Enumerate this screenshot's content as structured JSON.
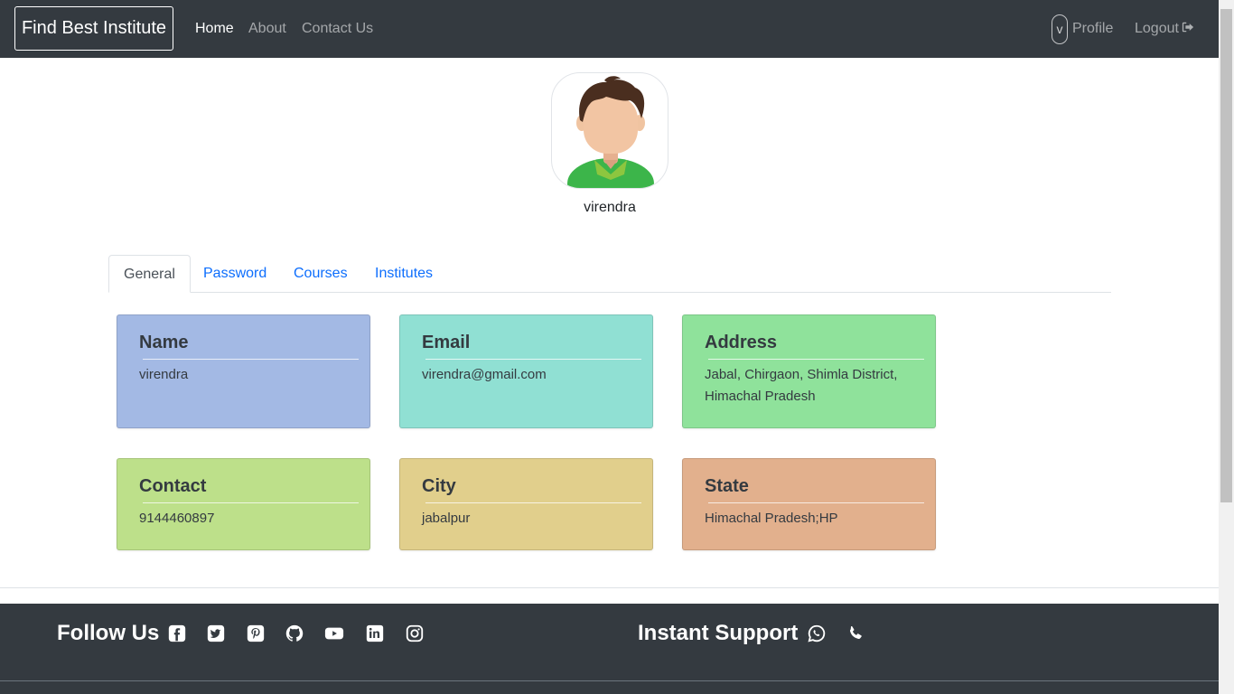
{
  "navbar": {
    "brand": "Find Best Institute",
    "links": [
      "Home",
      "About",
      "Contact Us"
    ],
    "avatar_initial": "v",
    "profile_label": "Profile",
    "logout_label": "Logout"
  },
  "profile": {
    "username": "virendra"
  },
  "tabs": [
    "General",
    "Password",
    "Courses",
    "Institutes"
  ],
  "active_tab": "General",
  "cards": [
    {
      "title": "Name",
      "value": "virendra",
      "color": "#a3b9e4"
    },
    {
      "title": "Email",
      "value": "virendra@gmail.com",
      "color": "#90e0d3"
    },
    {
      "title": "Address",
      "value": "Jabal, Chirgaon, Shimla District, Himachal Pradesh",
      "color": "#8fe29b"
    },
    {
      "title": "Contact",
      "value": "9144460897",
      "color": "#bde08a"
    },
    {
      "title": "City",
      "value": "jabalpur",
      "color": "#e1cf8c"
    },
    {
      "title": "State",
      "value": "Himachal Pradesh;HP",
      "color": "#e2b08d"
    }
  ],
  "footer": {
    "follow_heading": "Follow Us",
    "social_icons": [
      "facebook-icon",
      "twitter-icon",
      "pinterest-icon",
      "github-icon",
      "youtube-icon",
      "linkedin-icon",
      "instagram-icon"
    ],
    "support_heading": "Instant Support",
    "support_icons": [
      "whatsapp-icon",
      "phone-icon"
    ]
  },
  "colors": {
    "navbar_bg": "#343a40",
    "link_blue": "#0d6efd"
  }
}
